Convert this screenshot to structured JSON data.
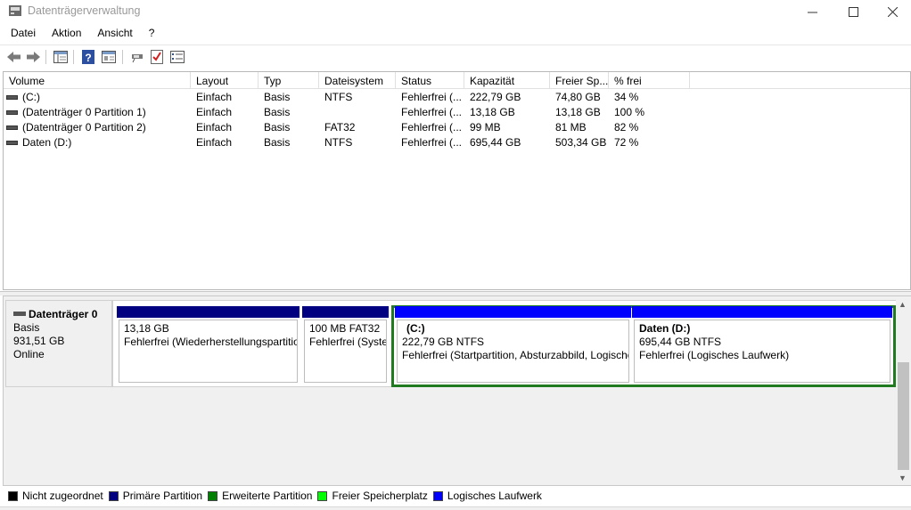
{
  "window": {
    "title": "Datenträgerverwaltung"
  },
  "menu": [
    "Datei",
    "Aktion",
    "Ansicht",
    "?"
  ],
  "columns": [
    "Volume",
    "Layout",
    "Typ",
    "Dateisystem",
    "Status",
    "Kapazität",
    "Freier Sp...",
    "% frei"
  ],
  "volumes": [
    {
      "name": "(C:)",
      "layout": "Einfach",
      "type": "Basis",
      "fs": "NTFS",
      "status": "Fehlerfrei (...",
      "capacity": "222,79 GB",
      "free": "74,80 GB",
      "pct": "34 %"
    },
    {
      "name": "(Datenträger 0 Partition 1)",
      "layout": "Einfach",
      "type": "Basis",
      "fs": "",
      "status": "Fehlerfrei (...",
      "capacity": "13,18 GB",
      "free": "13,18 GB",
      "pct": "100 %"
    },
    {
      "name": "(Datenträger 0 Partition 2)",
      "layout": "Einfach",
      "type": "Basis",
      "fs": "FAT32",
      "status": "Fehlerfrei (...",
      "capacity": "99 MB",
      "free": "81 MB",
      "pct": "82 %"
    },
    {
      "name": "Daten (D:)",
      "layout": "Einfach",
      "type": "Basis",
      "fs": "NTFS",
      "status": "Fehlerfrei (...",
      "capacity": "695,44 GB",
      "free": "503,34 GB",
      "pct": "72 %"
    }
  ],
  "disk": {
    "name": "Datenträger 0",
    "type": "Basis",
    "size": "931,51 GB",
    "state": "Online"
  },
  "partitions": [
    {
      "title": "",
      "size": "13,18 GB",
      "status": "Fehlerfrei (Wiederherstellungspartition)",
      "color": "#000080"
    },
    {
      "title": "",
      "size": "100 MB FAT32",
      "status": "Fehlerfrei (Systempartition)",
      "color": "#000080"
    },
    {
      "title": "(C:)",
      "size": "222,79 GB NTFS",
      "status": "Fehlerfrei (Startpartition, Absturzabbild, Logisches Laufwerk)",
      "color": "#0000ff"
    },
    {
      "title": "Daten  (D:)",
      "size": "695,44 GB NTFS",
      "status": "Fehlerfrei (Logisches Laufwerk)",
      "color": "#0000ff"
    }
  ],
  "legend": [
    {
      "label": "Nicht zugeordnet",
      "color": "#000000"
    },
    {
      "label": "Primäre Partition",
      "color": "#000080"
    },
    {
      "label": "Erweiterte Partition",
      "color": "#008000"
    },
    {
      "label": "Freier Speicherplatz",
      "color": "#00ff00"
    },
    {
      "label": "Logisches Laufwerk",
      "color": "#0000ff"
    }
  ],
  "icons": {
    "window": "disk-management-icon",
    "toolbar": [
      "back-icon",
      "forward-icon",
      "show-hide-console-tree-icon",
      "help-icon",
      "properties-icon",
      "connect-disk-icon",
      "check-icon",
      "list-view-icon"
    ]
  }
}
